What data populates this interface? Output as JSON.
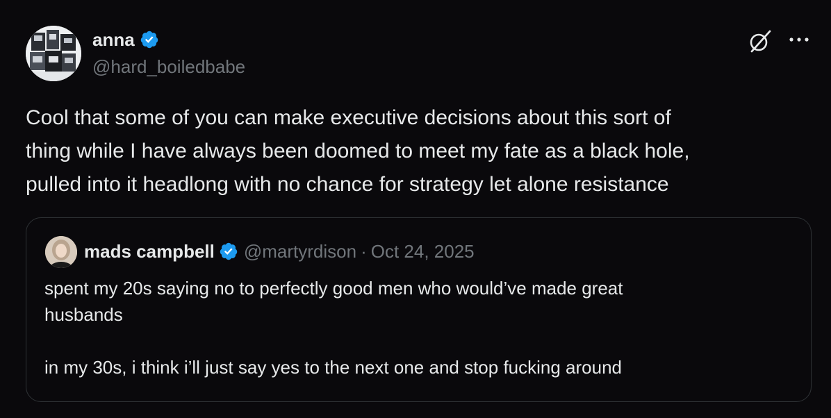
{
  "tweet": {
    "display_name": "anna",
    "handle": "@hard_boiledbabe",
    "text_lines": [
      "Cool that some of you can make executive decisions about this sort of",
      "thing while I have always been doomed to meet my fate as a black hole,",
      "pulled into it headlong with no chance for strategy let alone resistance"
    ],
    "verified": true
  },
  "quote": {
    "display_name": "mads campbell",
    "handle": "@martyrdison",
    "separator": "·",
    "date": "Oct 24, 2025",
    "verified": true,
    "text_lines": [
      "spent my 20s saying no to perfectly good men who would’ve made great",
      "husbands",
      "",
      "in my 30s, i think i’ll just say yes to the next one and stop fucking around"
    ]
  },
  "icons": {
    "verified": "verified-badge-icon",
    "grok": "grok-icon",
    "more": "more-icon"
  },
  "colors": {
    "background": "#0a090c",
    "text_primary": "#e7e9ea",
    "text_secondary": "#71767b",
    "verified_blue": "#1d9bf0",
    "border": "#2f3336"
  }
}
